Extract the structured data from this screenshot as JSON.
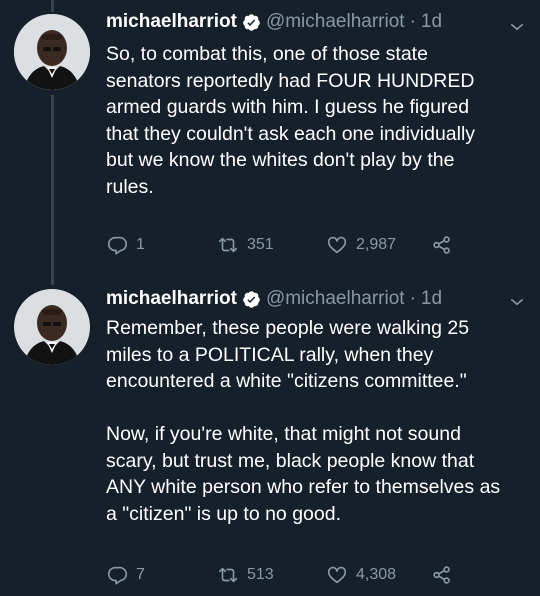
{
  "tweets": [
    {
      "display_name": "michaelharriot",
      "handle": "@michaelharriot",
      "separator": "·",
      "time": "1d",
      "text": "So, to combat this, one of those state\nsenators reportedly had FOUR HUNDRED\narmed guards with him. I guess he figured\nthat they couldn't ask each one individually\nbut we know the whites don't play by the\nrules.",
      "replies": "1",
      "retweets": "351",
      "likes": "2,987"
    },
    {
      "display_name": "michaelharriot",
      "handle": "@michaelharriot",
      "separator": "·",
      "time": "1d",
      "text": "Remember, these people were walking 25\nmiles to a POLITICAL rally, when they\nencountered a white \"citizens committee.\"\n\nNow, if you're white, that might not sound\nscary, but trust me, black people know that\nANY white person who refer to themselves as\na \"citizen\" is up to no good.",
      "replies": "7",
      "retweets": "513",
      "likes": "4,308"
    }
  ],
  "colors": {
    "background": "#15202b",
    "text": "#ffffff",
    "secondary": "#8899a6",
    "thread_line": "#38444d",
    "verified_badge": "#ffffff"
  },
  "icons": [
    "verified-icon",
    "chevron-down-icon",
    "reply-icon",
    "retweet-icon",
    "like-icon",
    "share-icon"
  ]
}
